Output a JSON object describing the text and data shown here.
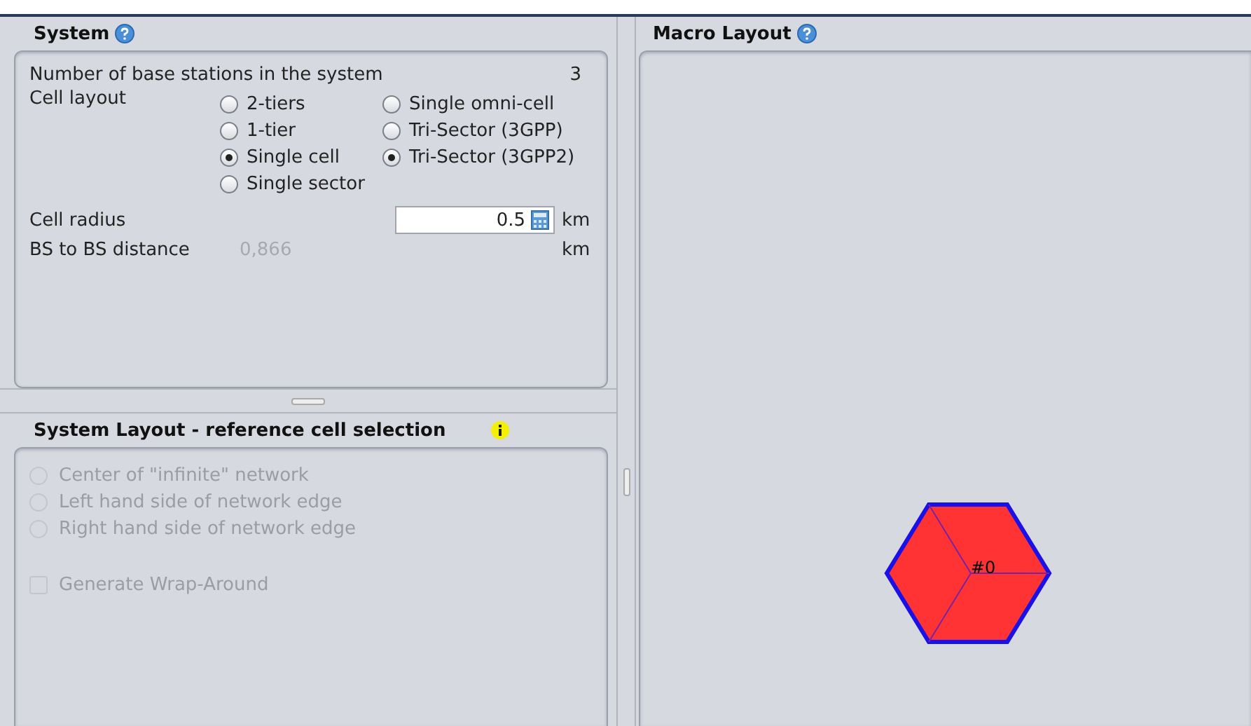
{
  "system": {
    "title": "System",
    "stations": {
      "label": "Number of base stations in the system",
      "value": "3"
    },
    "cell_layout": {
      "label": "Cell layout",
      "options": [
        {
          "label": "2-tiers",
          "selected": false
        },
        {
          "label": "Single omni-cell",
          "selected": false
        },
        {
          "label": "1-tier",
          "selected": false
        },
        {
          "label": "Tri-Sector (3GPP)",
          "selected": false
        },
        {
          "label": "Single cell",
          "selected": true
        },
        {
          "label": "Tri-Sector (3GPP2)",
          "selected": true
        },
        {
          "label": "Single sector",
          "selected": false
        }
      ]
    },
    "cell_radius": {
      "label": "Cell radius",
      "value": "0.5",
      "unit": "km"
    },
    "bs_distance": {
      "label": "BS to BS distance",
      "value": "0,866",
      "unit": "km"
    }
  },
  "reference": {
    "title": "System Layout - reference cell selection",
    "disabled": true,
    "options": [
      {
        "label": "Center of \"infinite\" network",
        "selected": false
      },
      {
        "label": "Left hand side of network edge",
        "selected": false
      },
      {
        "label": "Right hand side of network edge",
        "selected": false
      }
    ],
    "wrap_around": {
      "label": "Generate Wrap-Around",
      "checked": false
    }
  },
  "macro": {
    "title": "Macro Layout",
    "cell_label": "#0"
  }
}
